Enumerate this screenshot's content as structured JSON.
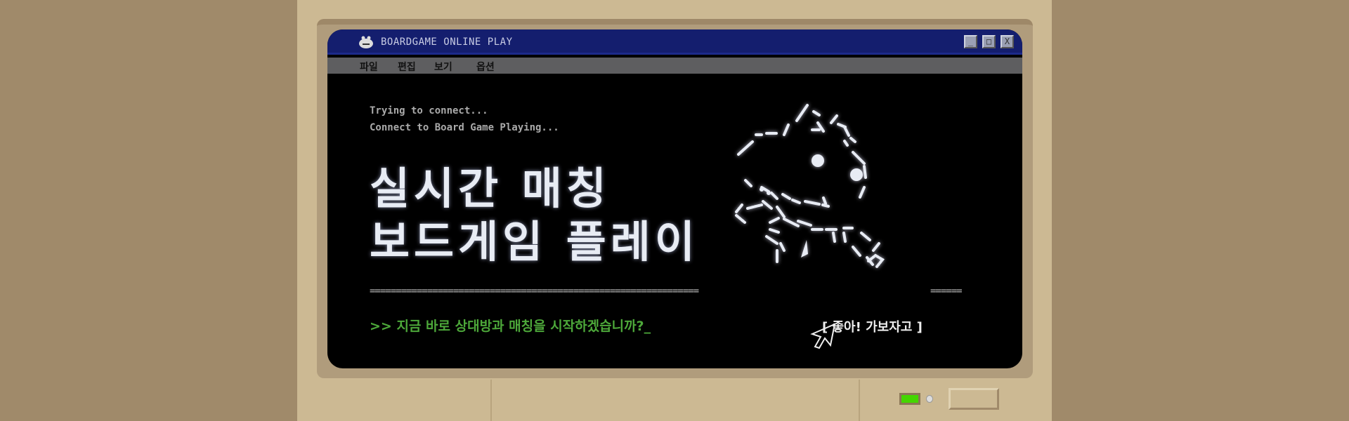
{
  "window": {
    "title": "BOARDGAME ONLINE PLAY",
    "controls": [
      "_",
      "□",
      "X"
    ]
  },
  "menu": [
    "파일",
    "편집",
    "보기",
    "옵션"
  ],
  "log": [
    "Trying to connect...",
    "Connect to Board Game Playing..."
  ],
  "headline": [
    "실시간 매칭",
    "보드게임 플레이"
  ],
  "divider_left": "===============================================================",
  "divider_right": "======",
  "prompt": ">> 지금 바로 상대방과 매칭을 시작하겠습니까?_",
  "cta": "[ 좋아! 가보자고  ]",
  "colors": {
    "titlebar": "#141e6e",
    "prompt": "#4da83a",
    "led": "#44d600",
    "case": "#ccb993"
  }
}
